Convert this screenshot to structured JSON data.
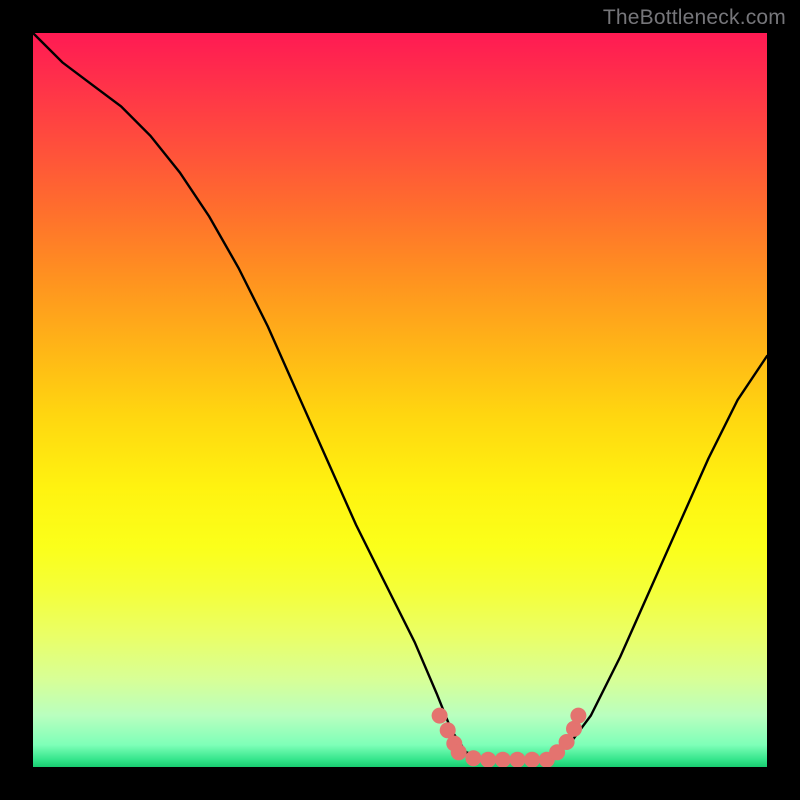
{
  "attribution": "TheBottleneck.com",
  "colors": {
    "curve": "#000000",
    "dots": "#e4736f",
    "frame": "#000000",
    "gradient_top": "#ff1a53",
    "gradient_bottom": "#18cc70"
  },
  "chart_data": {
    "type": "line",
    "title": "",
    "xlabel": "",
    "ylabel": "",
    "xlim": [
      0,
      100
    ],
    "ylim": [
      0,
      100
    ],
    "grid": false,
    "legend": false,
    "annotations": [
      "TheBottleneck.com"
    ],
    "series": [
      {
        "name": "bottleneck_curve",
        "x": [
          0,
          4,
          8,
          12,
          16,
          20,
          24,
          28,
          32,
          36,
          40,
          44,
          48,
          52,
          55,
          57,
          59,
          62,
          66,
          70,
          73,
          76,
          80,
          84,
          88,
          92,
          96,
          100
        ],
        "y": [
          100,
          96,
          93,
          90,
          86,
          81,
          75,
          68,
          60,
          51,
          42,
          33,
          25,
          17,
          10,
          5,
          2,
          1,
          1,
          1,
          3,
          7,
          15,
          24,
          33,
          42,
          50,
          56
        ]
      }
    ],
    "highlight_points": {
      "name": "optimal_region_dots",
      "x": [
        55.4,
        56.5,
        57.4,
        58.0,
        60.0,
        62.0,
        64.0,
        66.0,
        68.0,
        70.0,
        71.4,
        72.7,
        73.7,
        74.3
      ],
      "y": [
        7.0,
        5.0,
        3.2,
        2.0,
        1.2,
        1.0,
        1.0,
        1.0,
        1.0,
        1.0,
        2.0,
        3.4,
        5.2,
        7.0
      ]
    },
    "background": {
      "type": "vertical_gradient",
      "description": "red (top) through orange, yellow, to green (bottom)",
      "stops": [
        {
          "pos": 0.0,
          "color": "#ff1a53"
        },
        {
          "pos": 0.34,
          "color": "#ff941f"
        },
        {
          "pos": 0.62,
          "color": "#fff310"
        },
        {
          "pos": 0.93,
          "color": "#b9ffbf"
        },
        {
          "pos": 1.0,
          "color": "#18cc70"
        }
      ]
    }
  }
}
